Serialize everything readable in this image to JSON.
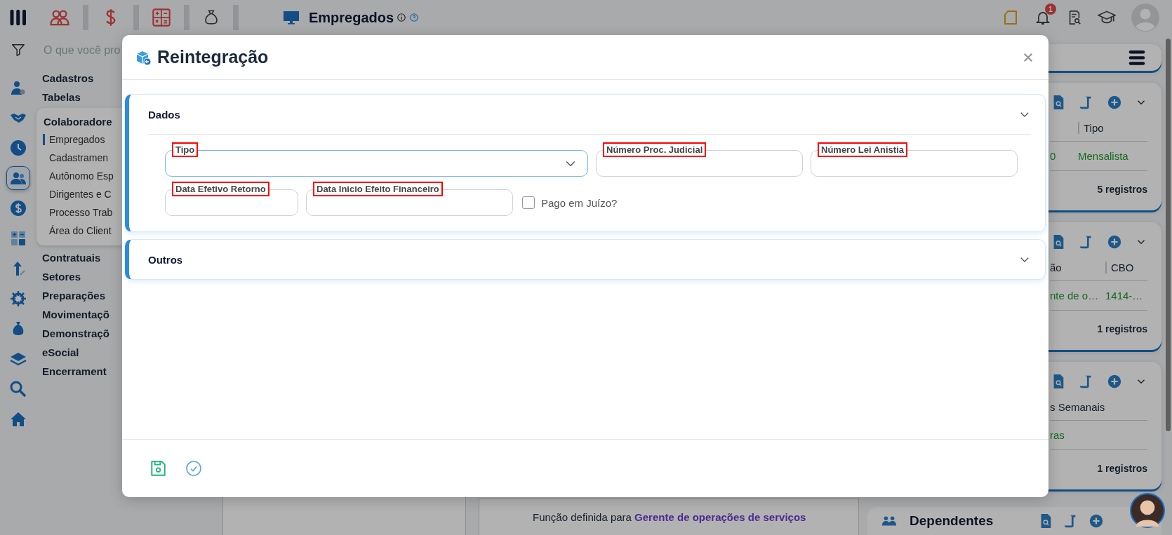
{
  "topbar": {
    "title": "Empregados",
    "notification_count": "1"
  },
  "search": {
    "placeholder": "O que você pro"
  },
  "sidebar_icons": [
    {
      "selected": false
    },
    {
      "selected": false
    },
    {
      "selected": false
    },
    {
      "selected": true
    },
    {
      "selected": false
    },
    {
      "selected": false
    },
    {
      "selected": false
    },
    {
      "selected": false
    },
    {
      "selected": false
    },
    {
      "selected": false
    },
    {
      "selected": false
    },
    {
      "selected": false
    }
  ],
  "menu": {
    "items_before": [
      {
        "label": "Cadastros"
      },
      {
        "label": "Tabelas"
      }
    ],
    "group": {
      "label": "Colaboradore",
      "items": [
        {
          "label": "Empregados",
          "selected": true
        },
        {
          "label": "Cadastramen",
          "selected": false
        },
        {
          "label": "Autônomo Esp",
          "selected": false
        },
        {
          "label": "Dirigentes e C",
          "selected": false
        },
        {
          "label": "Processo Trab",
          "selected": false
        },
        {
          "label": "Área do Client",
          "selected": false
        }
      ]
    },
    "items_after": [
      {
        "label": "Contratuais"
      },
      {
        "label": "Setores"
      },
      {
        "label": "Preparações"
      },
      {
        "label": "Movimentaçõ"
      },
      {
        "label": "Demonstraçõ"
      },
      {
        "label": "eSocial"
      },
      {
        "label": "Encerrament"
      }
    ]
  },
  "cards": [
    {
      "columns": [
        {
          "value": "0"
        },
        {
          "header": "Tipo",
          "value": "Mensalista"
        }
      ],
      "footer": "5 registros"
    },
    {
      "columns": [
        {
          "header": "ão",
          "value": "nte de o…"
        },
        {
          "header": "CBO",
          "value": "1414-…"
        }
      ],
      "footer": "1 registros"
    },
    {
      "columns": [
        {
          "header": "s Semanais",
          "value": "ras"
        }
      ],
      "footer": "1 registros"
    }
  ],
  "dependentes": {
    "title": "Dependentes"
  },
  "bottom_note": {
    "text": "Função definida para",
    "link": "Gerente de operações de serviços"
  },
  "modal": {
    "title": "Reintegração",
    "sections": [
      {
        "title": "Dados",
        "expanded": true,
        "rows": [
          [
            {
              "kind": "select",
              "label": "Tipo",
              "highlighted": true,
              "focused": true
            },
            {
              "kind": "text",
              "label": "Número Proc. Judicial",
              "highlighted": true,
              "focused": false
            },
            {
              "kind": "text",
              "label": "Número Lei Anistia",
              "highlighted": true,
              "focused": false
            }
          ],
          [
            {
              "kind": "text",
              "label": "Data Efetivo Retorno",
              "highlighted": true,
              "focused": false
            },
            {
              "kind": "text",
              "label": "Data Inicio Efeito Financeiro",
              "highlighted": true,
              "focused": false
            },
            {
              "kind": "checkbox",
              "label": "Pago em Juízo?",
              "checked": false
            }
          ]
        ]
      },
      {
        "title": "Outros",
        "expanded": false
      }
    ]
  }
}
